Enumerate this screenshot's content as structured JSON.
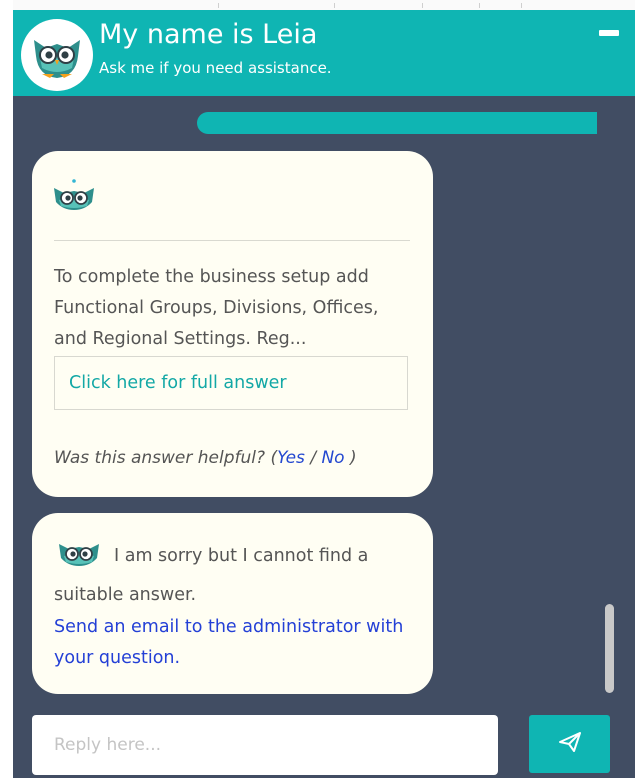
{
  "header": {
    "title": "My name is Leia",
    "subtitle": "Ask me if you need assistance.",
    "avatar_icon": "owl-mascot-icon",
    "minimize_icon": "minimize-icon"
  },
  "messages": [
    {
      "icon": "owl-mascot-icon",
      "text": "To complete the business setup add Functional Groups, Divisions, Offices, and Regional Settings. Reg...",
      "full_answer_link": "Click here for full answer",
      "helpful_prompt": "Was this answer helpful? (",
      "yes_label": "Yes",
      "separator": " / ",
      "no_label": "No",
      "closing": " )"
    },
    {
      "icon": "owl-mascot-icon",
      "text_line1": "I am sorry but I cannot find a",
      "text_line2": "suitable answer.",
      "email_link": "Send an email to the administrator with your question."
    }
  ],
  "reply": {
    "placeholder": "Reply here...",
    "send_icon": "send-icon"
  },
  "colors": {
    "accent": "#0fb5b3",
    "panel_background": "#414d63",
    "bubble_background": "#fffef3",
    "link_color": "#2440d6",
    "answer_link_color": "#13a8a6"
  }
}
